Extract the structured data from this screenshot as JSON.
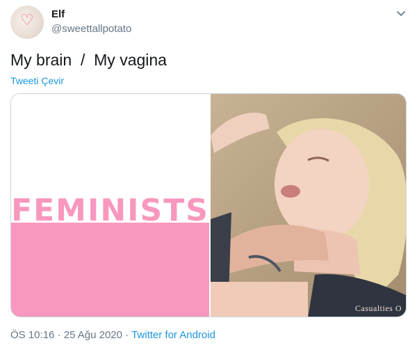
{
  "author": {
    "display_name": "Elf",
    "handle": "@sweettallpotato"
  },
  "tweet": {
    "text": "My brain  /  My vagina",
    "translate_label": "Tweeti Çevir"
  },
  "media": {
    "left_image_text": "FEMINISTS",
    "right_image_watermark": "Casualties O"
  },
  "meta": {
    "time": "ÖS 10:16",
    "separator": " · ",
    "date": "25 Ağu 2020",
    "source": "Twitter for Android"
  },
  "colors": {
    "link": "#1b95e0",
    "muted": "#657786",
    "pink": "#f898be"
  }
}
